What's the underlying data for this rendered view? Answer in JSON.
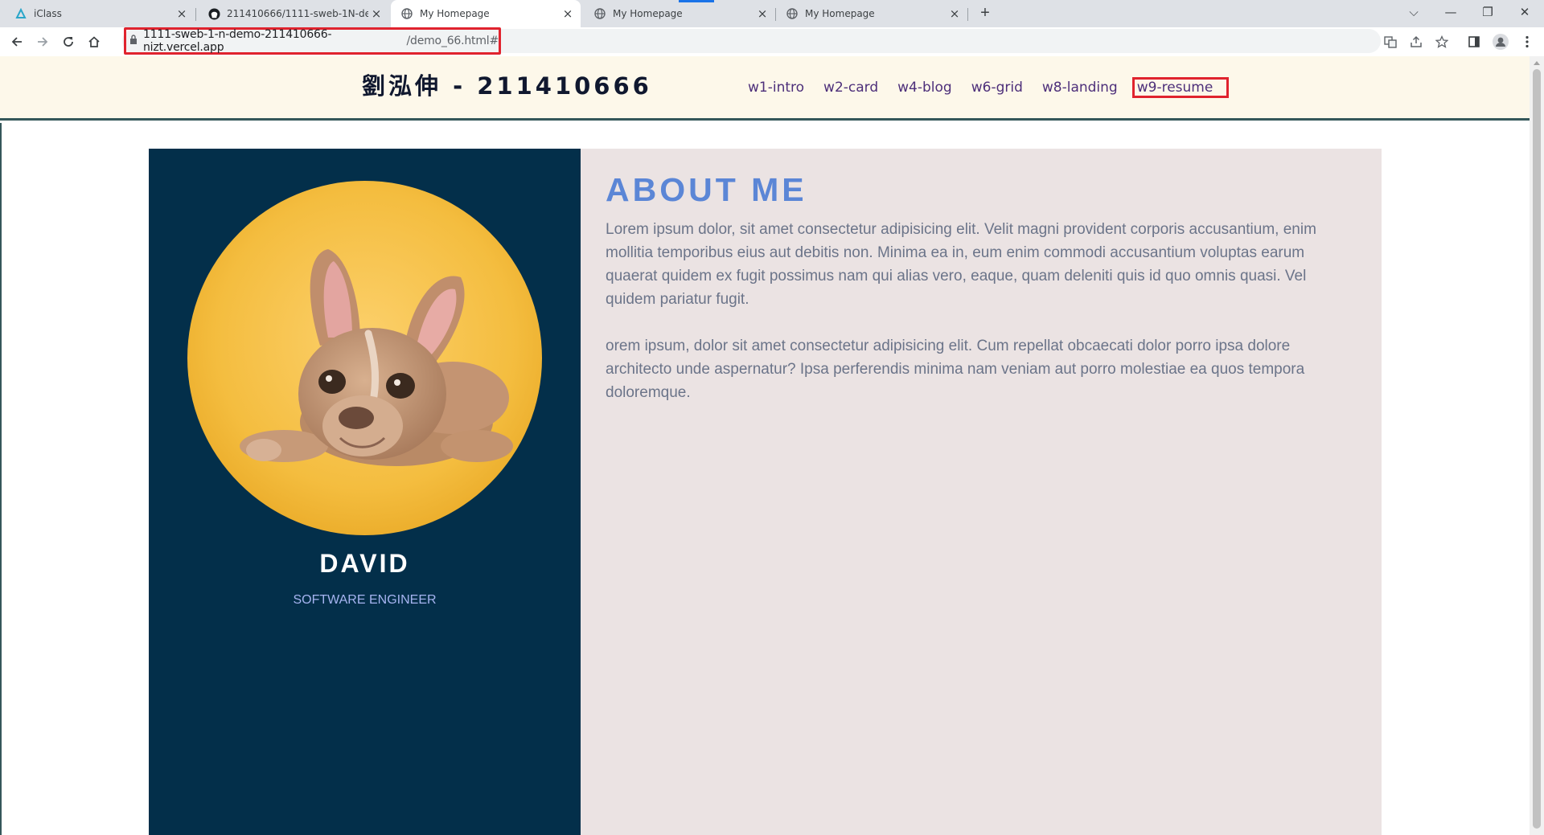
{
  "browser": {
    "tabs": [
      {
        "title": "iClass",
        "icon": "iclass-icon"
      },
      {
        "title": "211410666/1111-sweb-1N-de",
        "icon": "github-icon"
      },
      {
        "title": "My Homepage",
        "icon": "globe-icon",
        "active": true
      },
      {
        "title": "My Homepage",
        "icon": "globe-icon"
      },
      {
        "title": "My Homepage",
        "icon": "globe-icon"
      }
    ],
    "close_glyph": "×",
    "new_tab_glyph": "+",
    "address": {
      "host": "1111-sweb-1-n-demo-211410666-nizt.vercel.app",
      "path": "/demo_66.html#"
    },
    "window_controls": [
      "⌵",
      "—",
      "❐",
      "✕"
    ]
  },
  "site": {
    "title": "劉泓伸 - 211410666",
    "nav": [
      "w1-intro",
      "w2-card",
      "w4-blog",
      "w6-grid",
      "w8-landing",
      "w9-resume"
    ],
    "nav_highlighted": "w9-resume"
  },
  "profile": {
    "name": "DAVID",
    "role": "SOFTWARE ENGINEER",
    "photo": "french-bulldog-puppy-on-yellow"
  },
  "about": {
    "title": "ABOUT ME",
    "paragraphs": [
      "Lorem ipsum dolor, sit amet consectetur adipisicing elit. Velit magni provident corporis accusantium, enim mollitia temporibus eius aut debitis non. Minima ea in, eum enim commodi accusantium voluptas earum quaerat quidem ex fugit possimus nam qui alias vero, eaque, quam deleniti quis id quo omnis quasi. Vel quidem pariatur fugit.",
      "orem ipsum, dolor sit amet consectetur adipisicing elit. Cum repellat obcaecati dolor porro ipsa dolore architecto unde aspernatur? Ipsa perferendis minima nam veniam aut porro molestiae ea quos tempora doloremque."
    ]
  },
  "colors": {
    "header_bg": "#fdf8ea",
    "sidebar_bg": "#032f4a",
    "main_bg": "#ebe3e3",
    "accent_title": "#5b86d6",
    "highlight_box": "#e0232e"
  }
}
